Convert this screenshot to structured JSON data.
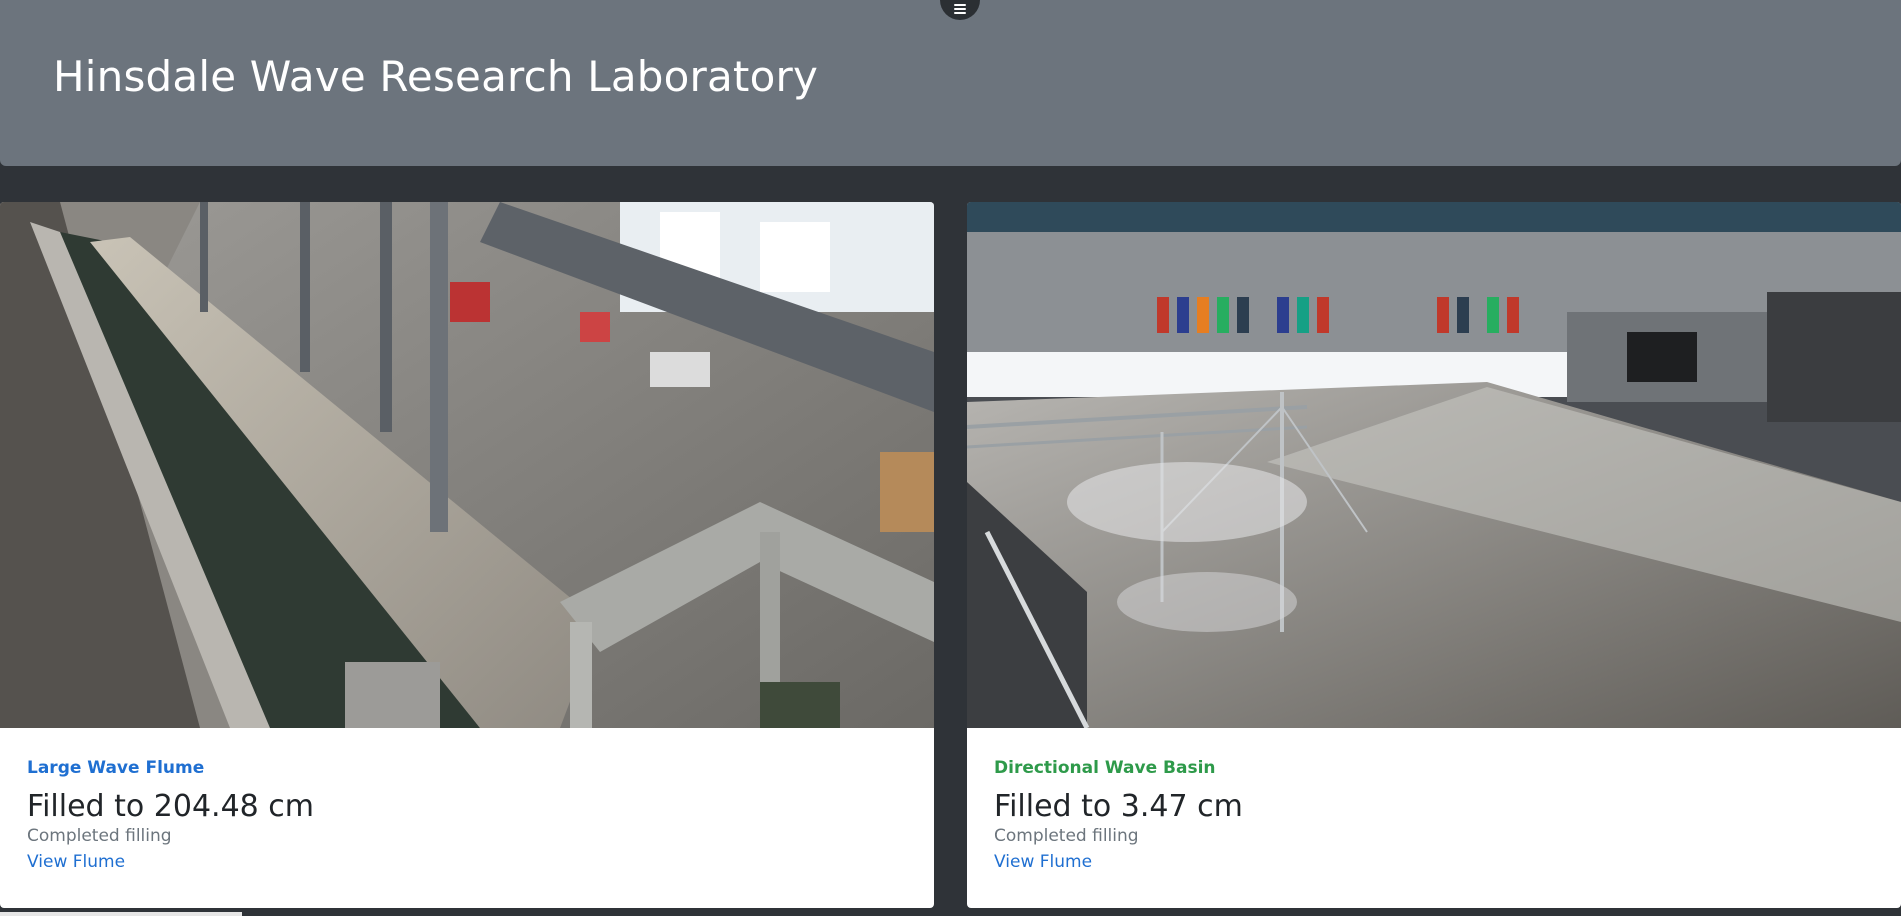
{
  "header": {
    "title": "Hinsdale Wave Research Laboratory",
    "menu_icon": "hamburger-menu-icon"
  },
  "facilities": [
    {
      "name": "Large Wave Flume",
      "name_color": "#1f6fd1",
      "fill_text": "Filled to 204.48 cm",
      "status": "Completed filling",
      "link_label": "View Flume",
      "camera": "large-wave-flume-camera-feed"
    },
    {
      "name": "Directional Wave Basin",
      "name_color": "#2e9a4a",
      "fill_text": "Filled to 3.47 cm",
      "status": "Completed filling",
      "link_label": "View Flume",
      "camera": "directional-wave-basin-camera-feed"
    }
  ],
  "colors": {
    "header_bg": "#6c747d",
    "page_bg": "#2f3338",
    "link": "#1f6fd1"
  }
}
